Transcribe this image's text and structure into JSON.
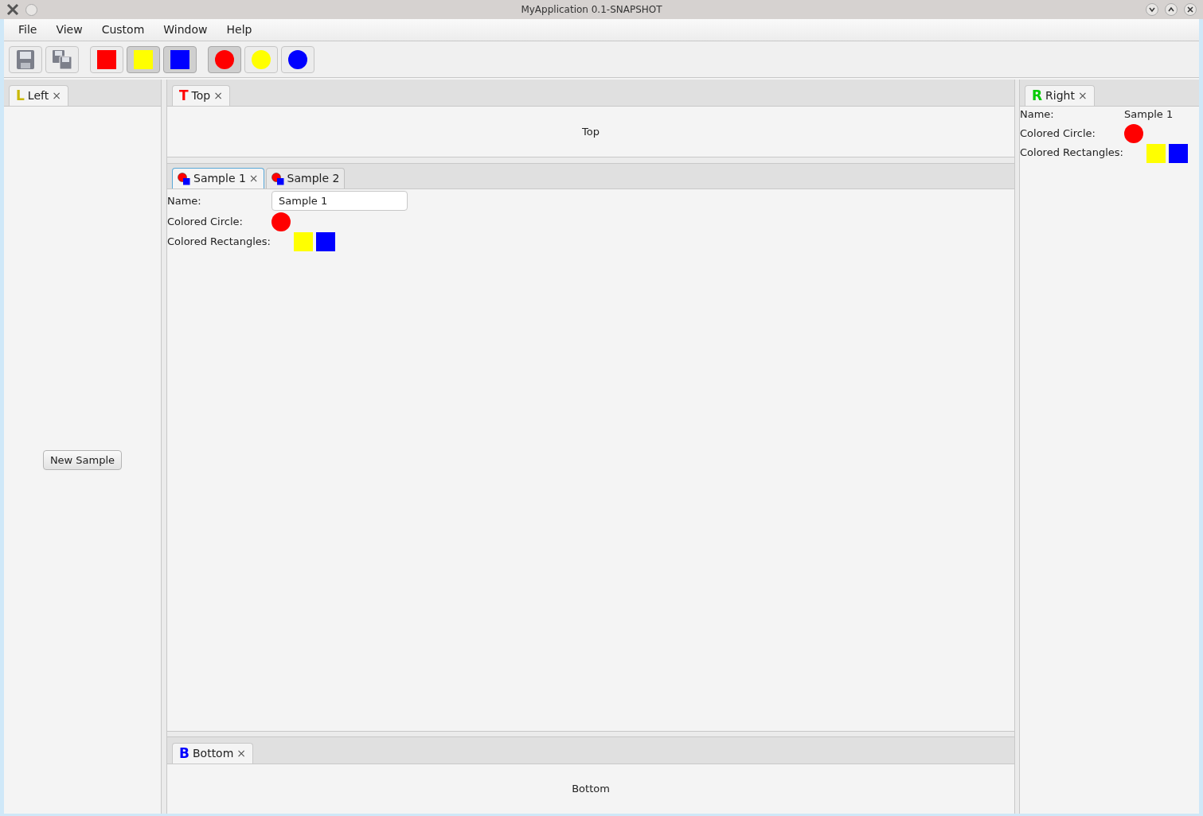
{
  "window": {
    "title": "MyApplication 0.1-SNAPSHOT"
  },
  "menu": [
    "File",
    "View",
    "Custom",
    "Window",
    "Help"
  ],
  "toolbar": [
    {
      "kind": "save",
      "selected": false
    },
    {
      "kind": "save-all",
      "selected": false
    },
    {
      "kind": "square",
      "color": "#ff0000",
      "selected": false
    },
    {
      "kind": "square",
      "color": "#ffff00",
      "selected": true
    },
    {
      "kind": "square",
      "color": "#0000ff",
      "selected": true
    },
    {
      "kind": "circle",
      "color": "#ff0000",
      "selected": true
    },
    {
      "kind": "circle",
      "color": "#ffff00",
      "selected": false
    },
    {
      "kind": "circle",
      "color": "#0000ff",
      "selected": false
    }
  ],
  "left": {
    "tab": {
      "glyph": "L",
      "label": "Left",
      "close": "×"
    },
    "button": "New Sample"
  },
  "top": {
    "tab": {
      "glyph": "T",
      "label": "Top",
      "close": "×"
    },
    "content": "Top"
  },
  "samples": {
    "tabs": [
      {
        "label": "Sample 1",
        "close": "×",
        "selected": true
      },
      {
        "label": "Sample 2",
        "selected": false
      }
    ],
    "name_label": "Name:",
    "name_value": "Sample 1",
    "circle_label": "Colored Circle:",
    "rects_label": "Colored Rectangles:",
    "rects": [
      {
        "color": "#ffff00"
      },
      {
        "color": "#0000ff"
      }
    ]
  },
  "bottom": {
    "tab": {
      "glyph": "B",
      "label": "Bottom",
      "close": "×"
    },
    "content": "Bottom"
  },
  "right": {
    "tab": {
      "glyph": "R",
      "label": "Right",
      "close": "×"
    },
    "name_label": "Name:",
    "name_value": "Sample 1",
    "circle_label": "Colored Circle:",
    "rects_label": "Colored Rectangles:",
    "rects": [
      {
        "color": "#ffff00"
      },
      {
        "color": "#0000ff"
      }
    ]
  }
}
